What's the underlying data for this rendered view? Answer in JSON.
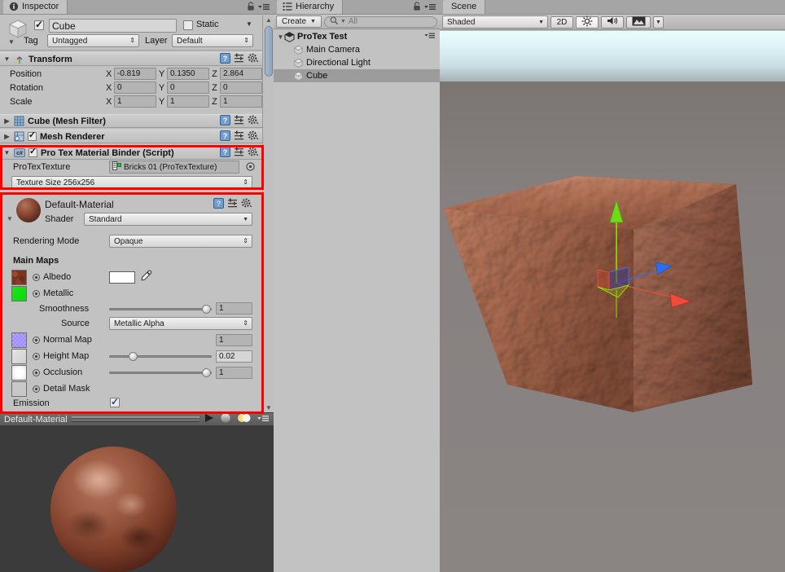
{
  "inspector": {
    "tab_label": "Inspector",
    "tab_icon": "info-icon",
    "object_name": "Cube",
    "enabled": true,
    "static_label": "Static",
    "tag_label": "Tag",
    "tag_value": "Untagged",
    "layer_label": "Layer",
    "layer_value": "Default",
    "transform": {
      "title": "Transform",
      "rows": [
        {
          "label": "Position",
          "x": "-0.819",
          "y": "0.1350",
          "z": "2.864"
        },
        {
          "label": "Rotation",
          "x": "0",
          "y": "0",
          "z": "0"
        },
        {
          "label": "Scale",
          "x": "1",
          "y": "1",
          "z": "1"
        }
      ],
      "axis_labels": [
        "X",
        "Y",
        "Z"
      ]
    },
    "components": [
      {
        "title": "Cube (Mesh Filter)",
        "icon": "mesh-filter-icon",
        "has_checkbox": false,
        "expanded": false
      },
      {
        "title": "Mesh Renderer",
        "icon": "mesh-renderer-icon",
        "has_checkbox": true,
        "checked": true,
        "expanded": false
      }
    ],
    "script_component": {
      "title": "Pro Tex Material Binder (Script)",
      "icon": "csharp-script-icon",
      "checked": true,
      "field_label": "ProTexTexture",
      "field_value": "Bricks 01 (ProTexTexture)",
      "texture_size_value": "Texture Size 256x256"
    },
    "material": {
      "name": "Default-Material",
      "shader_label": "Shader",
      "shader_value": "Standard",
      "rendering_mode_label": "Rendering Mode",
      "rendering_mode_value": "Opaque",
      "main_maps_label": "Main Maps",
      "maps": [
        {
          "label": "Albedo",
          "swatch": "#7a3420",
          "kind": "color",
          "color_value": "#ffffff",
          "has_eyedropper": true
        },
        {
          "label": "Metallic",
          "swatch": "#19e619",
          "kind": "none"
        },
        {
          "label": "Normal Map",
          "swatch": "#8f8fff",
          "kind": "value",
          "value": "1"
        },
        {
          "label": "Height Map",
          "swatch": "#d5d5d5",
          "kind": "slider",
          "value": "0.02",
          "fraction": 0.2
        },
        {
          "label": "Occlusion",
          "swatch": "#fafafa",
          "kind": "slider",
          "value": "1",
          "fraction": 1.0
        },
        {
          "label": "Detail Mask",
          "swatch": "#c8c8c8",
          "kind": "none"
        }
      ],
      "smoothness_label": "Smoothness",
      "smoothness_value": "1",
      "smoothness_fraction": 1.0,
      "source_label": "Source",
      "source_value": "Metallic Alpha",
      "emission_label": "Emission",
      "emission_checked": true
    },
    "preview": {
      "title": "Default-Material",
      "play_icon": "play-icon",
      "sphere_icon": "preview-sphere-icon",
      "lighting_icon": "preview-lighting-icon",
      "menu_icon": "preview-menu-icon"
    }
  },
  "hierarchy": {
    "tab_label": "Hierarchy",
    "tab_icon": "hierarchy-icon",
    "create_label": "Create",
    "search_placeholder": "All",
    "search_value": "",
    "search_icon": "search-icon",
    "scene_name": "ProTex Test",
    "items": [
      {
        "label": "Main Camera",
        "selected": false
      },
      {
        "label": "Directional Light",
        "selected": false
      },
      {
        "label": "Cube",
        "selected": true
      }
    ]
  },
  "scene": {
    "tab_label": "Scene",
    "draw_mode_value": "Shaded",
    "mode_2d_label": "2D",
    "lighting_icon": "lighting-toggle-icon",
    "audio_icon": "audio-toggle-icon",
    "effects_icon": "image-effects-icon",
    "effects_dropdown_icon": "chevron-down-icon",
    "gizmo": {
      "x_axis_color": "#f04a3a",
      "y_axis_color": "#8ee000",
      "z_axis_color": "#2a6df0"
    }
  },
  "colors": {
    "annotation": "#ff0000",
    "panel_bg": "#c2c2c2",
    "tabbar_bg": "#a5a5a5",
    "selection": "#9c9c9c",
    "preview_bg": "#3b3b3b"
  }
}
